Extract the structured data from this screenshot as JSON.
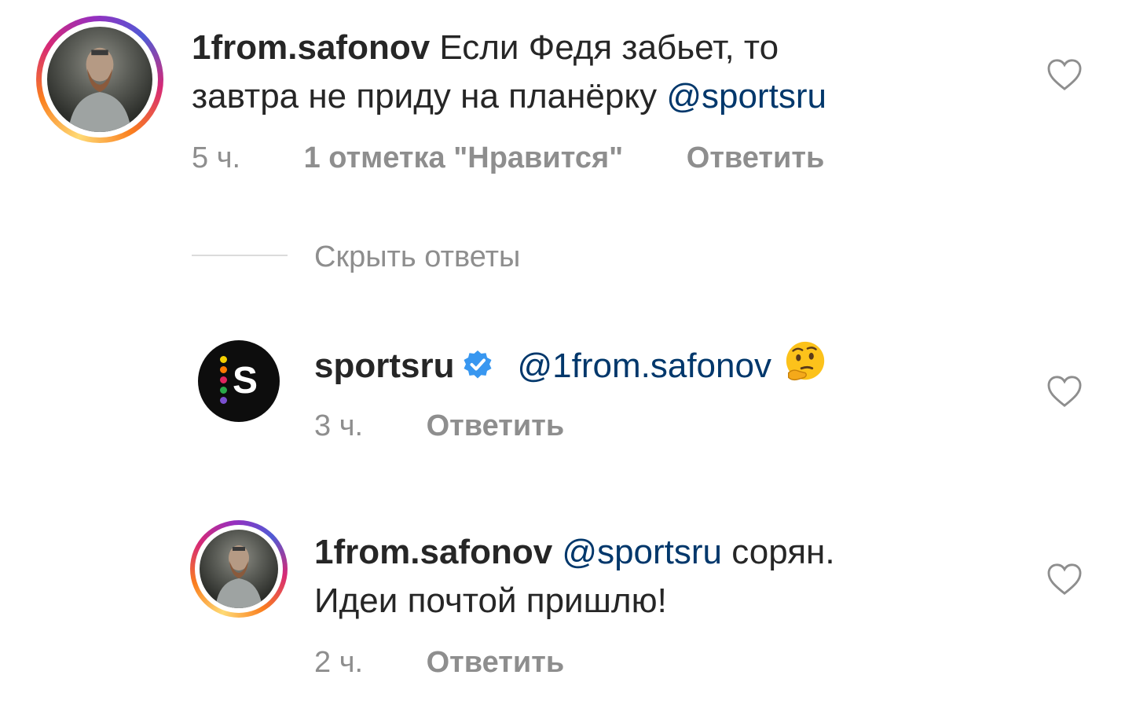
{
  "comments": [
    {
      "username": "1from.safonov",
      "text_line1": "Если Федя забьет, то",
      "text_line2": "завтра не приду на планёрку",
      "mention": "@sportsru",
      "time": "5 ч.",
      "likes": "1 отметка \"Нравится\"",
      "reply_label": "Ответить"
    }
  ],
  "hide_replies_label": "Скрыть ответы",
  "replies": [
    {
      "username": "sportsru",
      "verified": true,
      "mention": "@1from.safonov",
      "emoji": "thinking-face",
      "time": "3 ч.",
      "reply_label": "Ответить"
    },
    {
      "username": "1from.safonov",
      "mention": "@sportsru",
      "text_line1_suffix": "сорян.",
      "text_line2": "Идеи почтой пришлю!",
      "time": "2 ч.",
      "reply_label": "Ответить"
    }
  ],
  "colors": {
    "text": "#262626",
    "mention": "#00376b",
    "meta": "#8e8e8e",
    "verified": "#3897f0",
    "divider": "#dbdbdb"
  },
  "icons": [
    "heart-icon",
    "verified-badge-icon",
    "thinking-face-emoji"
  ]
}
